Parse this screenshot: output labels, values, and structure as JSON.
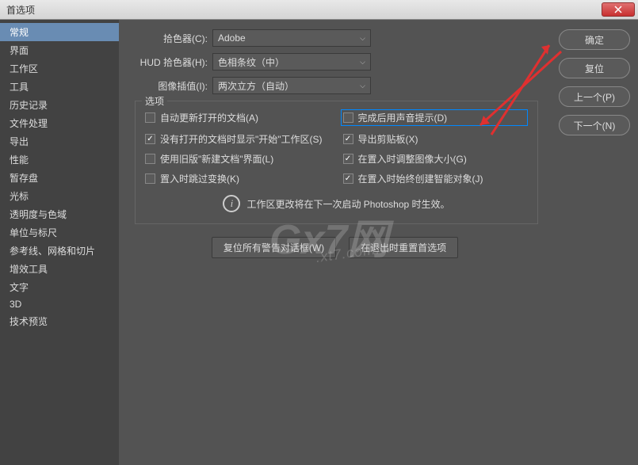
{
  "window": {
    "title": "首选项"
  },
  "sidebar": {
    "items": [
      {
        "label": "常规",
        "selected": true
      },
      {
        "label": "界面",
        "selected": false
      },
      {
        "label": "工作区",
        "selected": false
      },
      {
        "label": "工具",
        "selected": false
      },
      {
        "label": "历史记录",
        "selected": false
      },
      {
        "label": "文件处理",
        "selected": false
      },
      {
        "label": "导出",
        "selected": false
      },
      {
        "label": "性能",
        "selected": false
      },
      {
        "label": "暂存盘",
        "selected": false
      },
      {
        "label": "光标",
        "selected": false
      },
      {
        "label": "透明度与色域",
        "selected": false
      },
      {
        "label": "单位与标尺",
        "selected": false
      },
      {
        "label": "参考线、网格和切片",
        "selected": false
      },
      {
        "label": "增效工具",
        "selected": false
      },
      {
        "label": "文字",
        "selected": false
      },
      {
        "label": "3D",
        "selected": false
      },
      {
        "label": "技术预览",
        "selected": false
      }
    ]
  },
  "form": {
    "picker_label": "拾色器(C):",
    "picker_value": "Adobe",
    "hud_label": "HUD 拾色器(H):",
    "hud_value": "色相条纹（中）",
    "interp_label": "图像插值(I):",
    "interp_value": "两次立方（自动）"
  },
  "fieldset": {
    "legend": "选项",
    "checkboxes": {
      "auto_update": {
        "label": "自动更新打开的文档(A)",
        "checked": false
      },
      "show_start": {
        "label": "没有打开的文档时显示\"开始\"工作区(S)",
        "checked": true
      },
      "legacy_new": {
        "label": "使用旧版\"新建文档\"界面(L)",
        "checked": false
      },
      "skip_transform": {
        "label": "置入时跳过变换(K)",
        "checked": false
      },
      "beep": {
        "label": "完成后用声音提示(D)",
        "checked": false
      },
      "export_clipboard": {
        "label": "导出剪贴板(X)",
        "checked": true
      },
      "resize_place": {
        "label": "在置入时调整图像大小(G)",
        "checked": true
      },
      "smart_object": {
        "label": "在置入时始终创建智能对象(J)",
        "checked": true
      }
    },
    "info_text": "工作区更改将在下一次启动 Photoshop 时生效。"
  },
  "bottom": {
    "reset_warnings": "复位所有警告对话框(W)",
    "reset_on_quit": "在退出时重置首选项"
  },
  "buttons": {
    "ok": "确定",
    "reset": "复位",
    "prev": "上一个(P)",
    "next": "下一个(N)"
  },
  "watermark": {
    "main": "Gx7网",
    "sub": ".xt7.com.cn"
  }
}
